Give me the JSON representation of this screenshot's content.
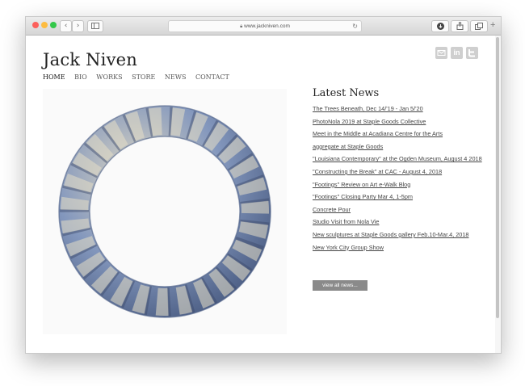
{
  "browser": {
    "url": "www.jackniven.com",
    "colors": {
      "close": "#fc605c",
      "minimize": "#fdbc40",
      "zoom": "#34c84a"
    },
    "icons": {
      "back": "chevron-left-icon",
      "forward": "chevron-right-icon",
      "sidebar": "sidebar-icon",
      "lock": "lock-icon",
      "reload": "reload-icon",
      "downloads": "download-icon",
      "share": "share-icon",
      "tabs": "tabs-icon",
      "new_tab": "plus-icon"
    }
  },
  "site": {
    "title": "Jack Niven",
    "nav": [
      "HOME",
      "BIO",
      "WORKS",
      "STORE",
      "NEWS",
      "CONTACT"
    ],
    "social": {
      "icons": [
        "email-icon",
        "linkedin-icon",
        "twitter-icon"
      ],
      "linkedin_label": "in"
    }
  },
  "hero": {
    "description": "twisted rope wreath sculpture",
    "colors": {
      "blue": "#6f86b0",
      "cream": "#e6dfc7",
      "dark": "#3b4a6b"
    }
  },
  "news": {
    "title": "Latest News",
    "items": [
      "The Trees Beneath, Dec 14/'19 - Jan 5/'20",
      "PhotoNola 2019 at Staple Goods Collective",
      "Meet in the Middle at Acadiana Centre for the Arts",
      "aggregate at Staple Goods",
      "\"Louisiana Contemporary\" at the Ogden Museum, August 4 2018",
      "\"Constructing the Break\" at CAC - August 4, 2018",
      "\"Footings\" Review on Art e-Walk Blog",
      "\"Footings\" Closing Party Mar 4, 1-5pm",
      "Concrete Pour",
      "Studio Visit from Nola Vie",
      "New sculptures at Staple Goods gallery Feb.10-Mar.4, 2018",
      "New York City Group Show"
    ],
    "view_all": "view all news..."
  }
}
